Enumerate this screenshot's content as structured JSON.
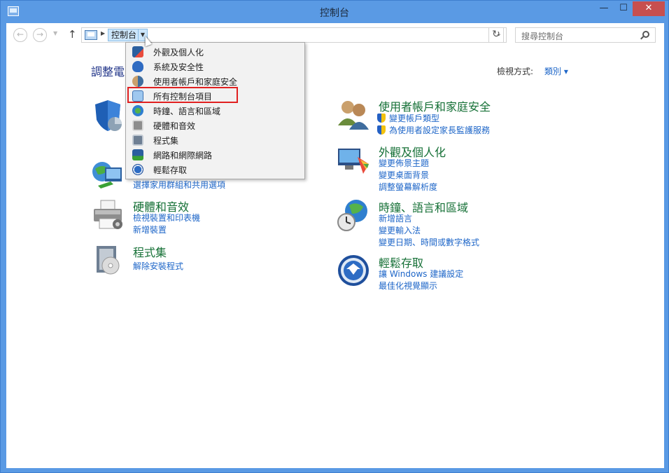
{
  "window": {
    "title": "控制台"
  },
  "navbar": {
    "breadcrumb": "控制台",
    "search_placeholder": "搜尋控制台"
  },
  "page": {
    "heading": "調整電",
    "view_by_label": "檢視方式:",
    "view_by_value": "類別 ▾"
  },
  "categories_left": [
    {
      "title": "",
      "links": []
    },
    {
      "title": "",
      "links": [
        "選擇家用群組和共用選項"
      ]
    },
    {
      "title": "硬體和音效",
      "links": [
        "檢視裝置和印表機",
        "新增裝置"
      ]
    },
    {
      "title": "程式集",
      "links": [
        "解除安裝程式"
      ]
    }
  ],
  "categories_right": [
    {
      "title": "使用者帳戶和家庭安全",
      "links": [
        "變更帳戶類型",
        "為使用者設定家長監護服務"
      ]
    },
    {
      "title": "外觀及個人化",
      "links": [
        "變更佈景主題",
        "變更桌面背景",
        "調整螢幕解析度"
      ]
    },
    {
      "title": "時鐘、語言和區域",
      "links": [
        "新增語言",
        "變更輸入法",
        "變更日期、時間或數字格式"
      ]
    },
    {
      "title": "輕鬆存取",
      "links": [
        "讓 Windows 建議設定",
        "最佳化視覺顯示"
      ]
    }
  ],
  "dropdown": {
    "items": [
      {
        "label": "外觀及個人化",
        "icon": "appearance-icon"
      },
      {
        "label": "系統及安全性",
        "icon": "system-security-icon"
      },
      {
        "label": "使用者帳戶和家庭安全",
        "icon": "user-accounts-icon"
      },
      {
        "label": "所有控制台項目",
        "icon": "control-panel-icon"
      },
      {
        "label": "時鐘、語言和區域",
        "icon": "clock-globe-icon"
      },
      {
        "label": "硬體和音效",
        "icon": "printer-icon"
      },
      {
        "label": "程式集",
        "icon": "programs-icon"
      },
      {
        "label": "網路和網際網路",
        "icon": "network-icon"
      },
      {
        "label": "輕鬆存取",
        "icon": "ease-of-access-icon"
      }
    ],
    "highlighted_index": 3
  },
  "colors": {
    "titlebar": "#5a9ae4",
    "category_title": "#157036",
    "link": "#1e66c8",
    "highlight_box": "#e02020"
  }
}
